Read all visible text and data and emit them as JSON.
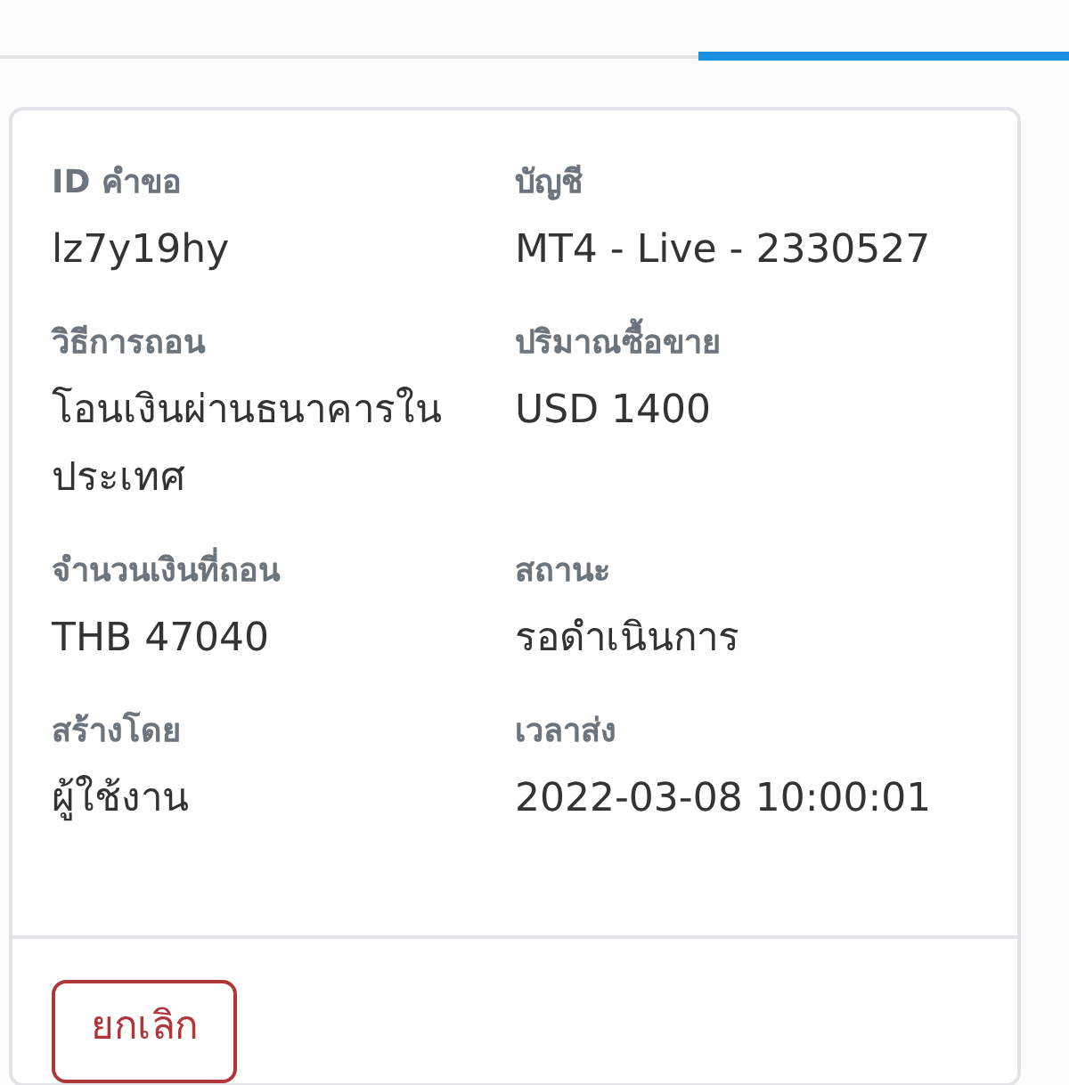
{
  "tabs": [
    {
      "selected": false
    },
    {
      "selected": true
    }
  ],
  "details": [
    {
      "label": "ID คำขอ",
      "value": "lz7y19hy"
    },
    {
      "label": "บัญชี",
      "value": "MT4 - Live - 2330527"
    },
    {
      "label": "วิธีการถอน",
      "value": "โอนเงินผ่านธนาคารในประเทศ"
    },
    {
      "label": "ปริมาณซื้อขาย",
      "value": "USD 1400"
    },
    {
      "label": "จำนวนเงินที่ถอน",
      "value": "THB 47040"
    },
    {
      "label": "สถานะ",
      "value": "รอดำเนินการ"
    },
    {
      "label": "สร้างโดย",
      "value": "ผู้ใช้งาน"
    },
    {
      "label": "เวลาส่ง",
      "value": "2022-03-08 10:00:01"
    }
  ],
  "buttons": [
    {
      "label": "ยกเลิก"
    }
  ]
}
